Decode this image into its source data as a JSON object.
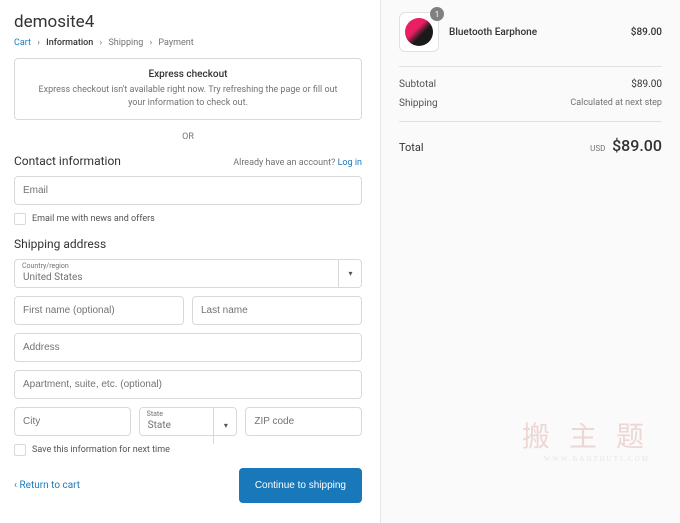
{
  "header": {
    "site_title": "demosite4"
  },
  "breadcrumb": {
    "cart": "Cart",
    "information": "Information",
    "shipping": "Shipping",
    "payment": "Payment"
  },
  "express": {
    "title": "Express checkout",
    "message": "Express checkout isn't available right now. Try refreshing the page or fill out your information to check out."
  },
  "or_separator": "OR",
  "contact": {
    "title": "Contact information",
    "login_prompt": "Already have an account?",
    "login_link": "Log in",
    "email_placeholder": "Email",
    "newsletter_label": "Email me with news and offers"
  },
  "shipping": {
    "title": "Shipping address",
    "country_label": "Country/region",
    "country_value": "United States",
    "first_name_placeholder": "First name (optional)",
    "last_name_placeholder": "Last name",
    "address_placeholder": "Address",
    "apt_placeholder": "Apartment, suite, etc. (optional)",
    "city_placeholder": "City",
    "state_label": "State",
    "state_value": "State",
    "zip_placeholder": "ZIP code",
    "save_label": "Save this information for next time"
  },
  "actions": {
    "return_label": "Return to cart",
    "continue_label": "Continue to shipping"
  },
  "cart": {
    "item": {
      "name": "Bluetooth Earphone",
      "qty": "1",
      "price": "$89.00"
    },
    "subtotal_label": "Subtotal",
    "subtotal_value": "$89.00",
    "shipping_label": "Shipping",
    "shipping_value": "Calculated at next step",
    "total_label": "Total",
    "total_currency": "USD",
    "total_value": "$89.00"
  },
  "watermark": {
    "text": "搬 主 题",
    "url": "WWW.BANZHUTI.COM"
  }
}
